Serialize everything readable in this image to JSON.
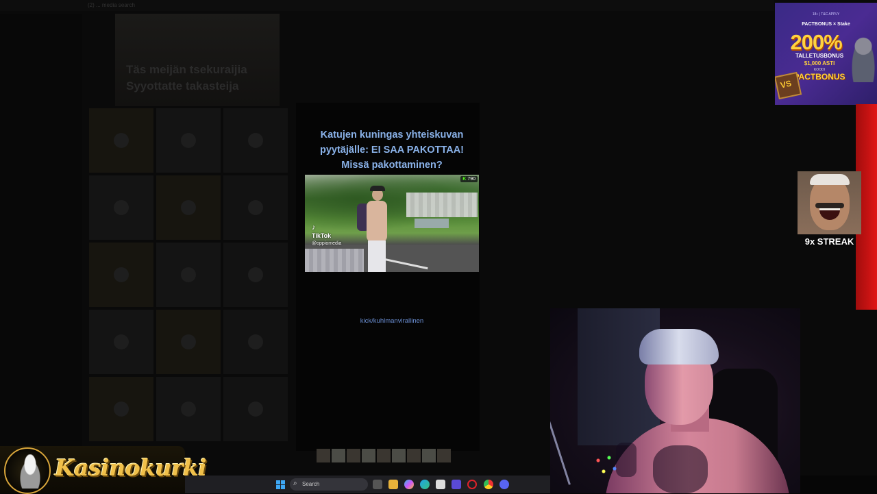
{
  "background_page": {
    "tab_title": "(2) ... media search",
    "header_text": [
      "Täs meijän tsekuraijia",
      "Syyottatte takasteija"
    ]
  },
  "video_card": {
    "caption": [
      "Katujen kuningas yhteiskuvan",
      "pyytäjälle: EI SAA PAKOTTAA!",
      "Missä pakottaminen?"
    ],
    "view_badge_k": "K",
    "view_badge_count": "790",
    "watermark_brand": "TikTok",
    "watermark_handle": "@oppiomedia",
    "link": "kick/kuhlmanvirallinen"
  },
  "sponsor_ad": {
    "top_small": "18+ | T&C APPLY",
    "brands": "PACTBONUS × Stake",
    "percent": "200%",
    "line1": "TALLETUSBONUS",
    "line2": "$1,000 ASTI",
    "line3": "KOODI",
    "code": "PACTBONUS",
    "chest": "VS"
  },
  "streak": {
    "label": "9x STREAK"
  },
  "logo": {
    "text": "Kasinokurki"
  },
  "taskbar": {
    "search_placeholder": "Search",
    "apps": [
      "file-explorer-icon",
      "folder-icon",
      "copilot-icon",
      "edge-icon",
      "store-icon",
      "app-icon",
      "opera-icon",
      "chrome-icon",
      "discord-icon"
    ]
  },
  "colors": {
    "caption": "#8ab2e9",
    "link": "#6b8fd4",
    "ad_gold": "#ffd23f",
    "ad_purple": "#3a2a86",
    "red_bar": "#e01616",
    "logo_gold": "#f0c04a"
  }
}
